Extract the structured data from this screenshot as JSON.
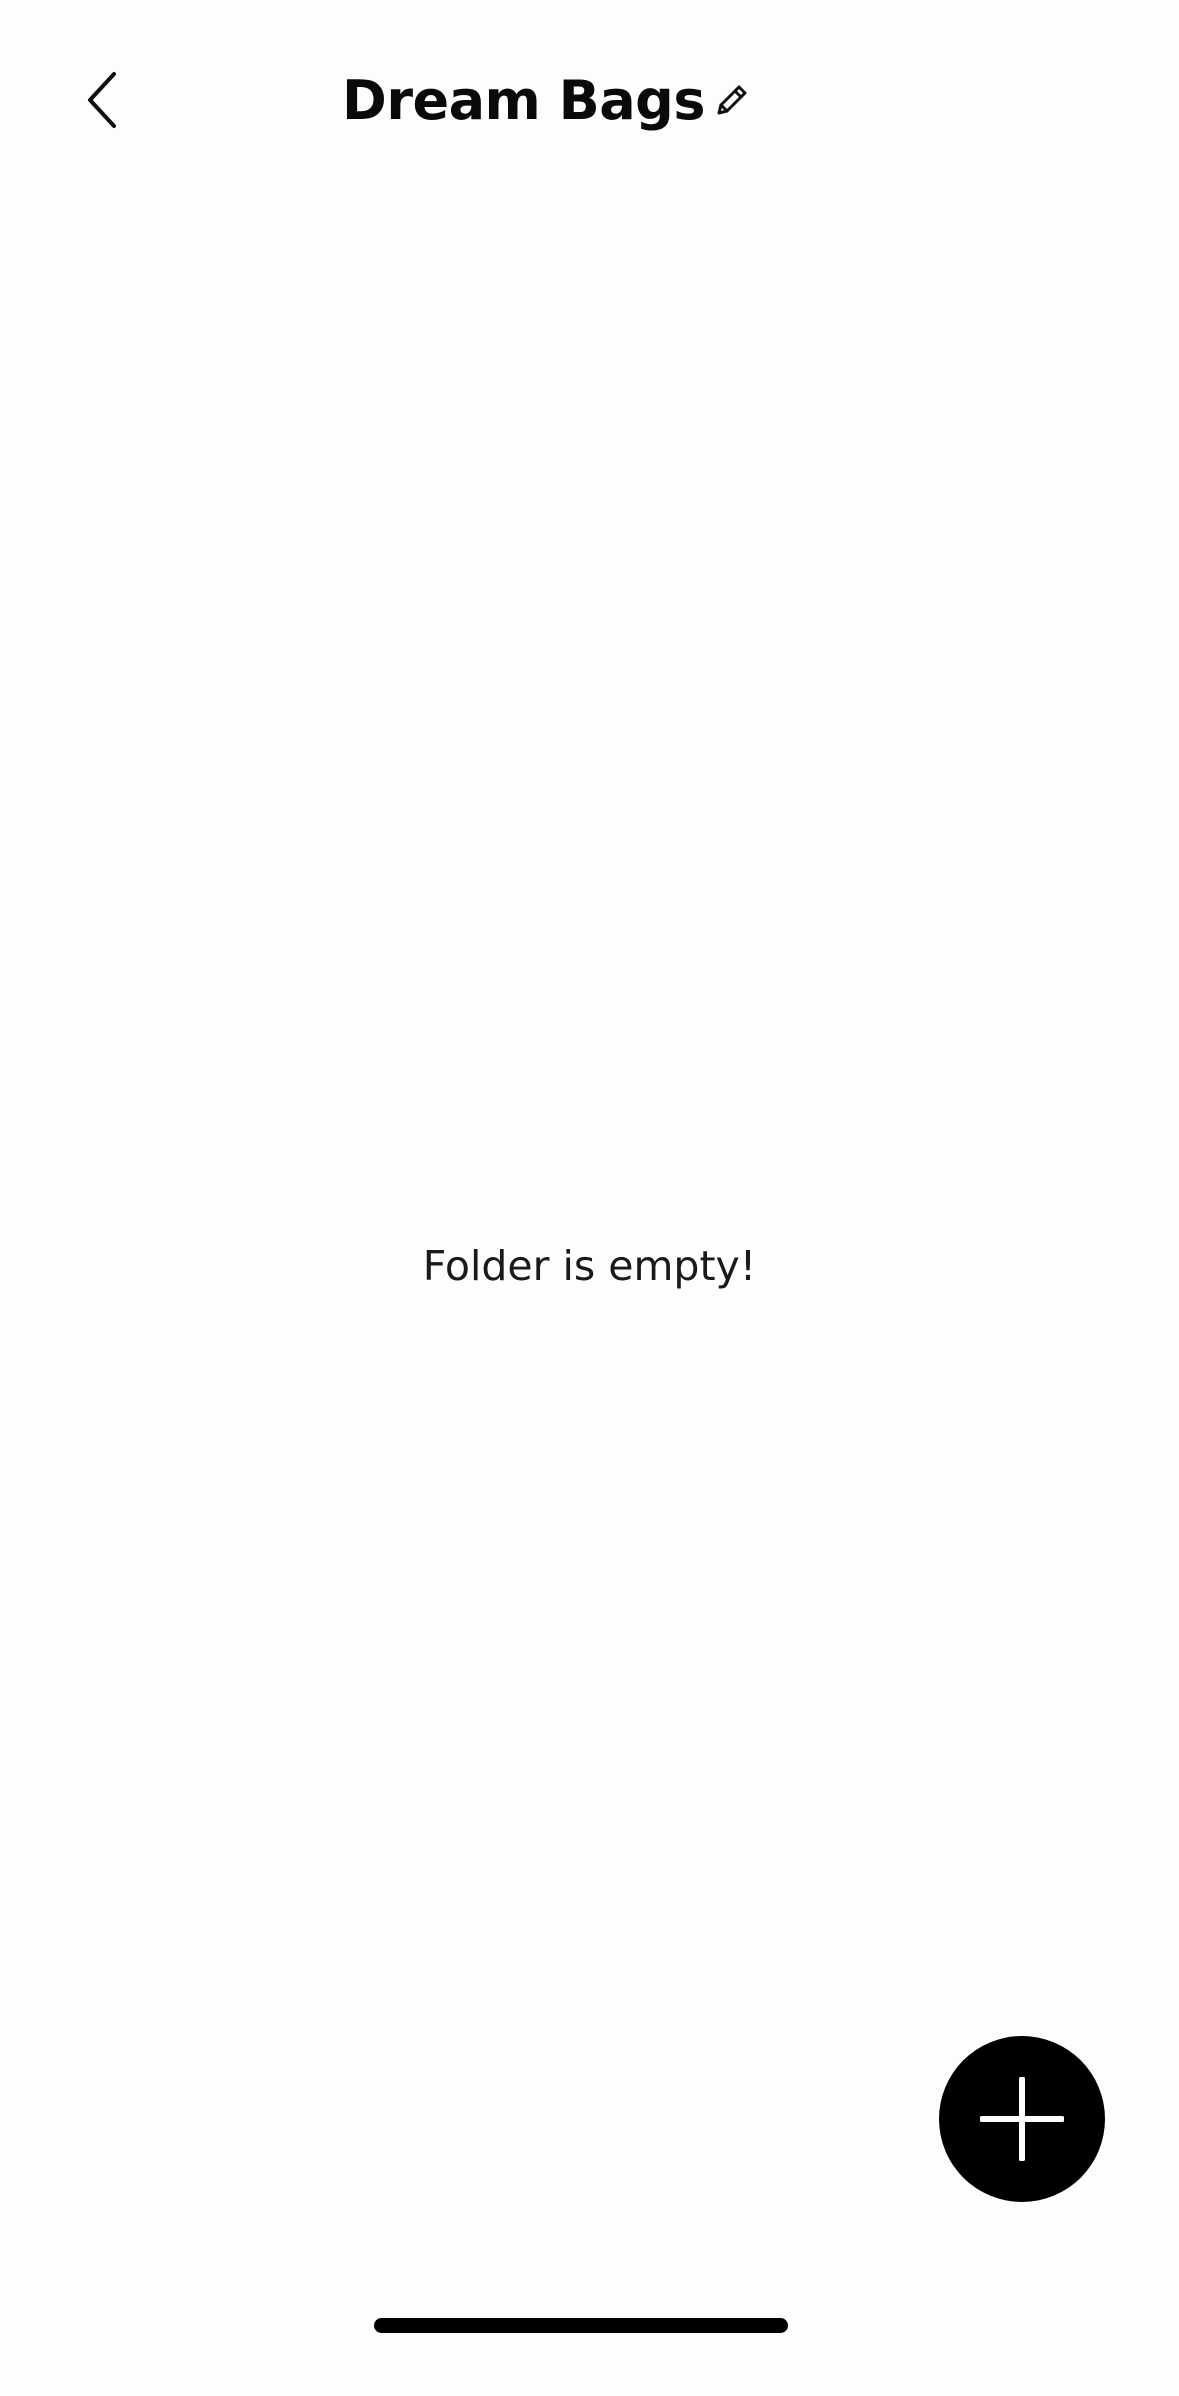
{
  "header": {
    "title": "Dream Bags",
    "back_icon": "chevron-left-icon",
    "edit_icon": "pencil-icon"
  },
  "main": {
    "empty_message": "Folder is empty!"
  },
  "fab": {
    "icon": "plus-icon",
    "color": "#000000"
  },
  "colors": {
    "background": "#fdfdfd",
    "text": "#0a0a0a"
  }
}
